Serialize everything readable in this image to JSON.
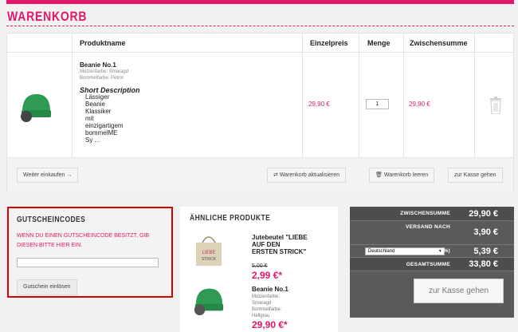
{
  "page": {
    "title": "WARENKORB"
  },
  "cart": {
    "headers": {
      "name": "Produktname",
      "unit_price": "Einzelpreis",
      "qty": "Menge",
      "subtotal": "Zwischensumme"
    },
    "item": {
      "name": "Beanie No.1",
      "attr1": "Mützenfarbe: Smaragd",
      "attr2": "Bommelfarbe: Petrol",
      "short_desc_title": "Short Description",
      "short_desc_lines": [
        "Lässiger",
        "Beanie",
        "Klassiker",
        "mit",
        "einzigartigem",
        "bommelME",
        "Sy ..."
      ],
      "unit_price": "29,90 €",
      "qty": "1",
      "subtotal": "29,90 €",
      "thumb_color": "#2e9a53",
      "pompom_color": "#444444"
    },
    "buttons": {
      "continue": "Weiter einkaufen",
      "update": "Warenkorb aktualisieren",
      "empty": "Warenkorb leeren",
      "checkout": "zur Kasse gehen"
    }
  },
  "coupon": {
    "title": "GUTSCHEINCODES",
    "text": "WENN DU EINEN GUTSCHEINCODE BESITZT, GIB DIESEN BITTE HIER EIN.",
    "input_value": "",
    "redeem": "Gutschein einlösen"
  },
  "similar": {
    "title": "ÄHNLICHE PRODUKTE",
    "products": [
      {
        "name": "Jutebeutel \"LIEBE AUF DEN ERSTEN STRICK\"",
        "old_price": "5,00 €",
        "price": "2,99 €*"
      },
      {
        "name": "Beanie No.1",
        "attrs": [
          "Mützenfarbe:",
          "Smaragd",
          "Bommelfarbe:",
          "Hellgrau"
        ],
        "price": "29,90 €*"
      }
    ]
  },
  "totals": {
    "subtotal_label": "ZWISCHENSUMME",
    "subtotal": "29,90 €",
    "shipping_label": "VERSAND NACH",
    "country": "Deutschland",
    "shipping": "3,90 €",
    "vat_label": "MWST. (19%)",
    "vat": "5,39 €",
    "total_label": "GESAMTSUMME",
    "total": "33,80 €",
    "checkout": "zur Kasse gehen"
  },
  "colors": {
    "accent": "#e4166b",
    "coupon_border": "#d60000",
    "totals_bg": "#5a5a5a"
  }
}
